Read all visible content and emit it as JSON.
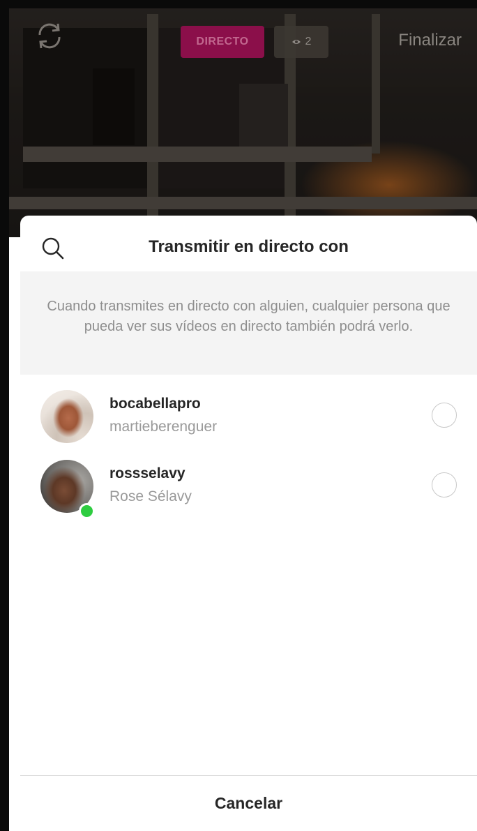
{
  "camera": {
    "live_label": "DIRECTO",
    "viewer_count": "2",
    "finish_label": "Finalizar",
    "icons": [
      "switch-camera-icon",
      "eye-icon"
    ]
  },
  "sheet": {
    "title": "Transmitir en directo con",
    "notice": "Cuando transmites en directo con alguien, cualquier persona que pueda ver sus vídeos en directo también podrá verlo.",
    "users": [
      {
        "username": "bocabellapro",
        "fullname": "martieberenguer",
        "online": false,
        "selected": false
      },
      {
        "username": "rossselavy",
        "fullname": "Rose Sélavy",
        "online": true,
        "selected": false
      }
    ],
    "cancel_label": "Cancelar"
  },
  "colors": {
    "live_badge": "#8b0f4a",
    "online": "#2ecc40",
    "title_text": "#262626",
    "secondary_text": "#9a9a9a"
  }
}
